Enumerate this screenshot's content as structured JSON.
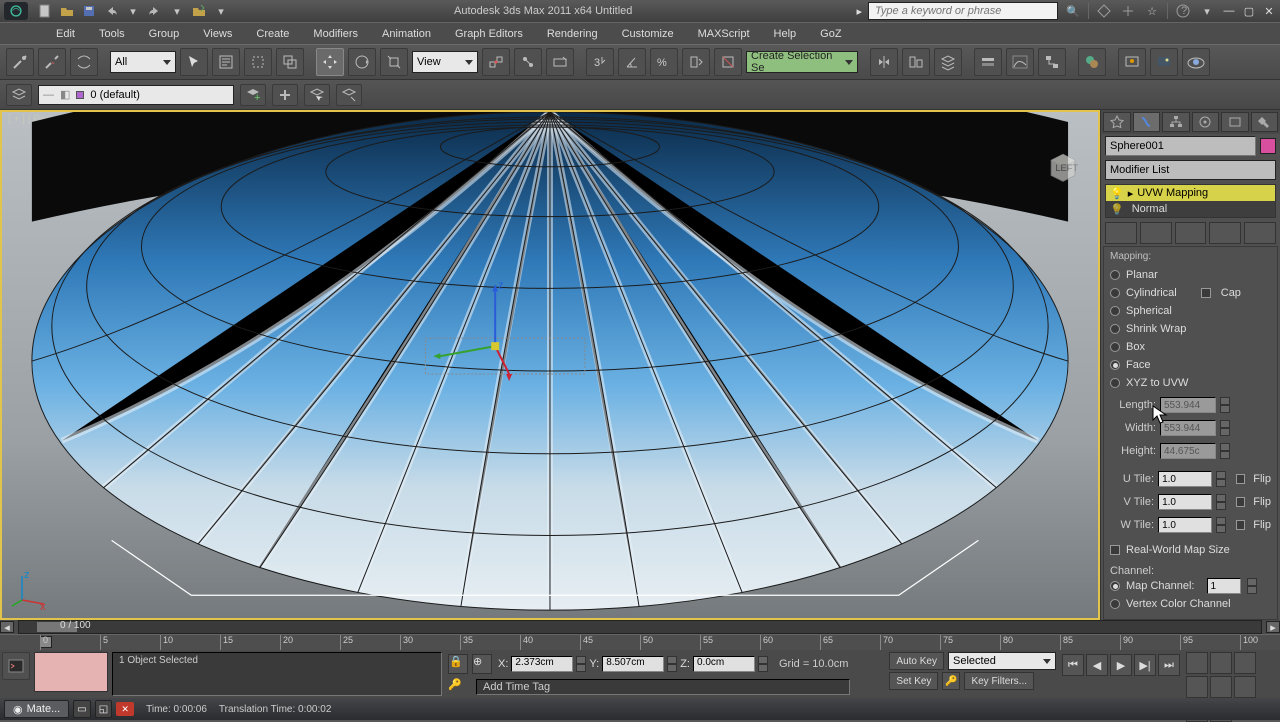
{
  "app": {
    "title": "Autodesk 3ds Max  2011 x64     Untitled"
  },
  "search": {
    "placeholder": "Type a keyword or phrase"
  },
  "menu": [
    "Edit",
    "Tools",
    "Group",
    "Views",
    "Create",
    "Modifiers",
    "Animation",
    "Graph Editors",
    "Rendering",
    "Customize",
    "MAXScript",
    "Help",
    "GoZ"
  ],
  "toolbar": {
    "sel_filter": "All",
    "ref_coord": "View",
    "named_sel": "Create Selection Se"
  },
  "layer": {
    "current": "0 (default)"
  },
  "viewport": {
    "label": "[ + ] [ Perspective ] [ Smooth + Highlights + Edged Faces ]",
    "axis_z": "z",
    "axis_x": "x",
    "cube_left": "LEFT"
  },
  "panel": {
    "object_name": "Sphere001",
    "modifier_list": "Modifier List",
    "stack_item_sel": "UVW Mapping",
    "stack_item_2": "Normal",
    "section": "Mapping:",
    "radios": [
      "Planar",
      "Cylindrical",
      "Spherical",
      "Shrink Wrap",
      "Box",
      "Face",
      "XYZ to UVW"
    ],
    "cap": "Cap",
    "len_l": "Length:",
    "wid_l": "Width:",
    "hgt_l": "Height:",
    "len_v": "553.944",
    "wid_v": "553.944",
    "hgt_v": "44.675c",
    "utile_l": "U Tile:",
    "vtile_l": "V Tile:",
    "wtile_l": "W Tile:",
    "utile_v": "1.0",
    "vtile_v": "1.0",
    "wtile_v": "1.0",
    "flip": "Flip",
    "realworld": "Real-World Map Size",
    "channel": "Channel:",
    "mapch": "Map Channel:",
    "mapch_v": "1",
    "vcch": "Vertex Color Channel"
  },
  "timeline": {
    "frame": "0 / 100",
    "ticks": [
      0,
      5,
      10,
      15,
      20,
      25,
      30,
      35,
      40,
      45,
      50,
      55,
      60,
      65,
      70,
      75,
      80,
      85,
      90,
      95,
      100
    ]
  },
  "status": {
    "selected": "1 Object Selected",
    "x": "X:",
    "xv": "2.373cm",
    "y": "Y:",
    "yv": "8.507cm",
    "z": "Z:",
    "zv": "0.0cm",
    "grid": "Grid = 10.0cm",
    "add_tag": "Add Time Tag",
    "autokey": "Auto Key",
    "setkey": "Set Key",
    "selected_dd": "Selected",
    "keyfilters": "Key Filters..."
  },
  "taskbar": {
    "item": "Mate...",
    "time": "Time: 0:00:06",
    "trans": "Translation Time: 0:00:02"
  }
}
